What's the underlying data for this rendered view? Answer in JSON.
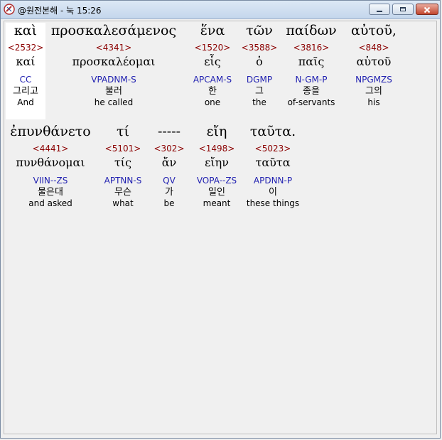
{
  "window": {
    "title": "@원전본해 - 눅 15:26"
  },
  "line1": [
    {
      "greek": "καὶ",
      "strong": "<2532>",
      "lemma": "καί",
      "parse": "CC",
      "korean": "그리고",
      "english": "And"
    },
    {
      "greek": "προσκαλεσάμενος",
      "strong": "<4341>",
      "lemma": "προσκαλέομαι",
      "parse": "VPADNM-S",
      "korean": "불러",
      "english": "he called"
    },
    {
      "greek": "ἕνα",
      "strong": "<1520>",
      "lemma": "εἷς",
      "parse": "APCAM-S",
      "korean": "한",
      "english": "one"
    },
    {
      "greek": "τῶν",
      "strong": "<3588>",
      "lemma": "ὁ",
      "parse": "DGMP",
      "korean": "그",
      "english": "the"
    },
    {
      "greek": "παίδων",
      "strong": "<3816>",
      "lemma": "παῖς",
      "parse": "N-GM-P",
      "korean": "종을",
      "english": "of-servants"
    },
    {
      "greek": "αὐτοῦ,",
      "strong": "<848>",
      "lemma": "αὑτοῦ",
      "parse": "NPGMZS",
      "korean": "그의",
      "english": "his"
    }
  ],
  "line2": [
    {
      "greek": "ἐπυνθάνετο",
      "strong": "<4441>",
      "lemma": "πυνθάνομαι",
      "parse": "VIIN--ZS",
      "korean": "물은대",
      "english": "and asked"
    },
    {
      "greek": "τί",
      "strong": "<5101>",
      "lemma": "τίς",
      "parse": "APTNN-S",
      "korean": "무슨",
      "english": "what"
    },
    {
      "greek": "-----",
      "strong": "<302>",
      "lemma": "ἄν",
      "parse": "QV",
      "korean": "가",
      "english": "be"
    },
    {
      "greek": "εἴη",
      "strong": "<1498>",
      "lemma": "εἴην",
      "parse": "VOPA--ZS",
      "korean": "일인",
      "english": "meant"
    },
    {
      "greek": "ταῦτα.",
      "strong": "<5023>",
      "lemma": "ταῦτα",
      "parse": "APDNN-P",
      "korean": "이",
      "english": "these things"
    }
  ]
}
